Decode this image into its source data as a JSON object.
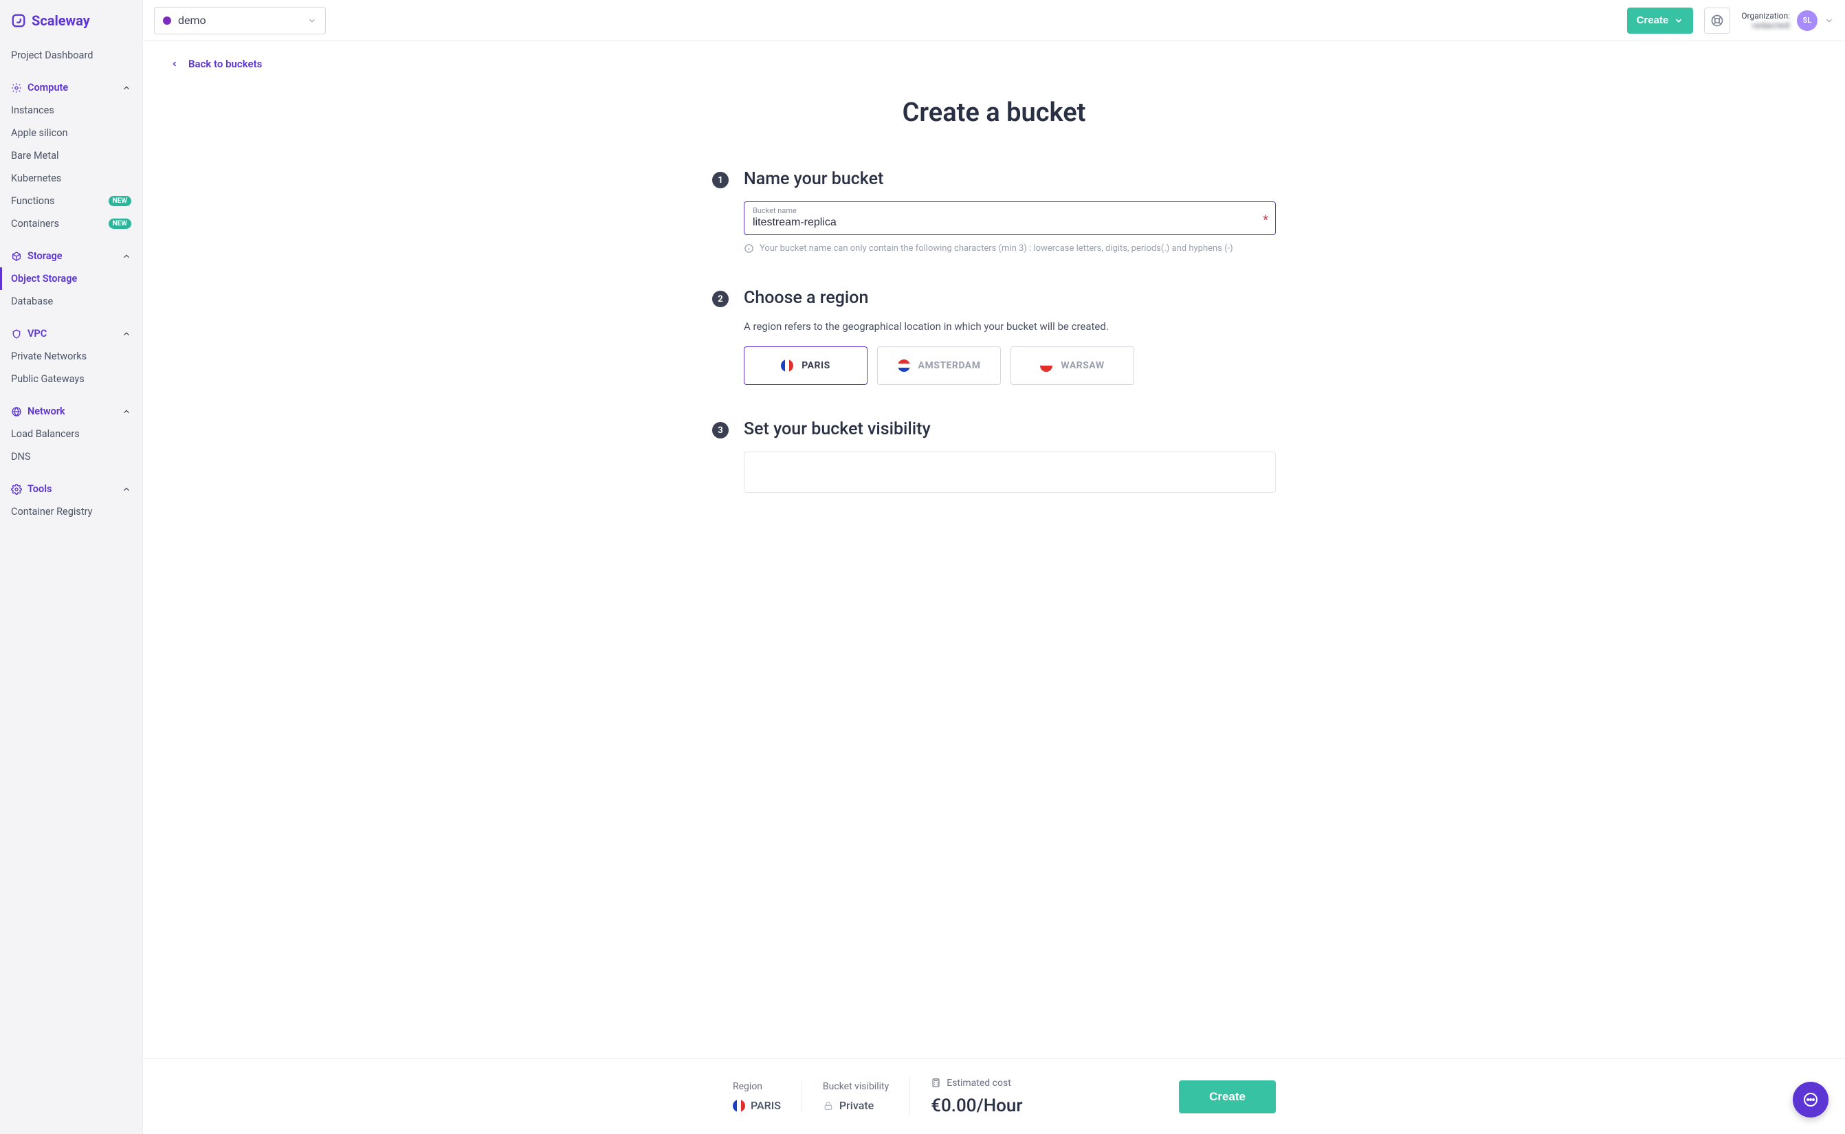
{
  "brand": "Scaleway",
  "sidebar": {
    "dashboard": "Project Dashboard",
    "groups": [
      {
        "title": "Compute",
        "items": [
          {
            "label": "Instances"
          },
          {
            "label": "Apple silicon"
          },
          {
            "label": "Bare Metal"
          },
          {
            "label": "Kubernetes"
          },
          {
            "label": "Functions",
            "badge": "NEW"
          },
          {
            "label": "Containers",
            "badge": "NEW"
          }
        ]
      },
      {
        "title": "Storage",
        "items": [
          {
            "label": "Object Storage",
            "active": true
          },
          {
            "label": "Database"
          }
        ]
      },
      {
        "title": "VPC",
        "items": [
          {
            "label": "Private Networks"
          },
          {
            "label": "Public Gateways"
          }
        ]
      },
      {
        "title": "Network",
        "items": [
          {
            "label": "Load Balancers"
          },
          {
            "label": "DNS"
          }
        ]
      },
      {
        "title": "Tools",
        "items": [
          {
            "label": "Container Registry"
          }
        ]
      }
    ]
  },
  "topbar": {
    "project": "demo",
    "create": "Create",
    "org_label": "Organization:",
    "org_name": "redacted",
    "avatar": "SL"
  },
  "back_link": "Back to buckets",
  "page_title": "Create a bucket",
  "step1": {
    "title": "Name your bucket",
    "field_label": "Bucket name",
    "value": "litestream-replica",
    "hint": "Your bucket name can only contain the following characters (min 3) : lowercase letters, digits, periods(.) and hyphens (-)"
  },
  "step2": {
    "title": "Choose a region",
    "subtitle": "A region refers to the geographical location in which your bucket will be created.",
    "regions": [
      {
        "code": "PARIS",
        "flag": "fr",
        "selected": true
      },
      {
        "code": "AMSTERDAM",
        "flag": "nl",
        "selected": false
      },
      {
        "code": "WARSAW",
        "flag": "pl",
        "selected": false
      }
    ]
  },
  "step3": {
    "title": "Set your bucket visibility"
  },
  "summary": {
    "region_label": "Region",
    "region_value": "PARIS",
    "visibility_label": "Bucket visibility",
    "visibility_value": "Private",
    "cost_label": "Estimated cost",
    "cost_value": "€0.00/Hour",
    "create": "Create"
  }
}
